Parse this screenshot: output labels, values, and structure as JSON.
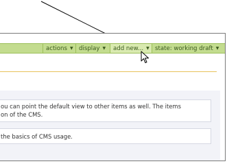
{
  "toolbar": {
    "menus": [
      {
        "label": "actions"
      },
      {
        "label": "display"
      },
      {
        "label": "add new..."
      },
      {
        "label": "state: working draft"
      }
    ]
  },
  "content": {
    "box1_line1": "ou can point the default view to other items as well. The items",
    "box1_line2": "on of the CMS.",
    "box2_line1": "the basics of CMS usage."
  },
  "colors": {
    "toolbar_bg": "#c3dc8f",
    "toolbar_text": "#3b5a1e",
    "rule": "#e7c25a",
    "content_bg": "#f2f3f8"
  },
  "icons": {
    "caret": "triangle-down",
    "cursor": "mouse-pointer"
  }
}
